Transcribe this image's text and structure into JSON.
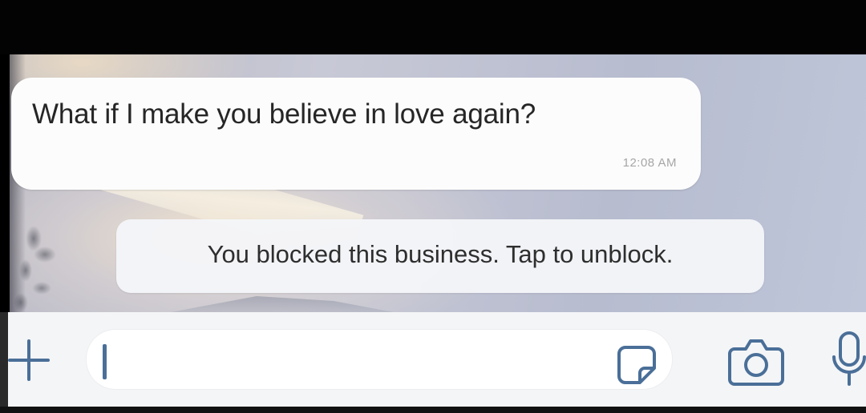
{
  "chat": {
    "message": {
      "text": "What if I make you believe in love again?",
      "time": "12:08 AM"
    },
    "system_notice": {
      "text": "You blocked this business. Tap to unblock."
    }
  },
  "input_bar": {
    "text_field_value": "",
    "icons": {
      "plus": "plus-icon",
      "sticker": "sticker-icon",
      "camera": "camera-icon",
      "mic": "microphone-icon"
    },
    "accent_color": "#4a6f98"
  }
}
